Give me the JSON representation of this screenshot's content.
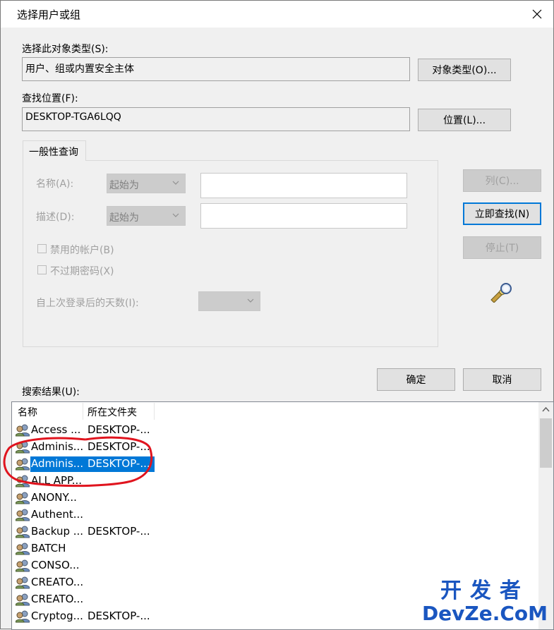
{
  "window": {
    "title": "选择用户或组"
  },
  "object_types": {
    "label": "选择此对象类型(S):",
    "value": "用户、组或内置安全主体",
    "button": "对象类型(O)..."
  },
  "location": {
    "label": "查找位置(F):",
    "value": "DESKTOP-TGA6LQQ",
    "button": "位置(L)..."
  },
  "query": {
    "tab": "一般性查询",
    "name_label": "名称(A):",
    "name_combo": "起始为",
    "desc_label": "描述(D):",
    "desc_combo": "起始为",
    "disabled_accounts": "禁用的帐户(B)",
    "no_expire": "不过期密码(X)",
    "days_label": "自上次登录后的天数(I):"
  },
  "side_buttons": {
    "columns": "列(C)...",
    "find_now": "立即查找(N)",
    "stop": "停止(T)"
  },
  "footer": {
    "ok": "确定",
    "cancel": "取消",
    "results_label": "搜索结果(U):"
  },
  "results": {
    "headers": [
      "名称",
      "所在文件夹"
    ],
    "rows": [
      {
        "name": "Access ...",
        "folder": "DESKTOP-..."
      },
      {
        "name": "Adminis...",
        "folder": "DESKTOP-..."
      },
      {
        "name": "Adminis...",
        "folder": "DESKTOP-...",
        "selected": true
      },
      {
        "name": "ALL APP...",
        "folder": ""
      },
      {
        "name": "ANONY...",
        "folder": ""
      },
      {
        "name": "Authent...",
        "folder": ""
      },
      {
        "name": "Backup ...",
        "folder": "DESKTOP-..."
      },
      {
        "name": "BATCH",
        "folder": ""
      },
      {
        "name": "CONSO...",
        "folder": ""
      },
      {
        "name": "CREATO...",
        "folder": ""
      },
      {
        "name": "CREATO...",
        "folder": ""
      },
      {
        "name": "Cryptog...",
        "folder": "DESKTOP-..."
      }
    ]
  },
  "watermark": {
    "line1": "开发者",
    "line2": "DevZe.CoM"
  },
  "colors": {
    "accent": "#0078d7",
    "annotation": "#e0141e",
    "watermark": "#1a56c0"
  }
}
